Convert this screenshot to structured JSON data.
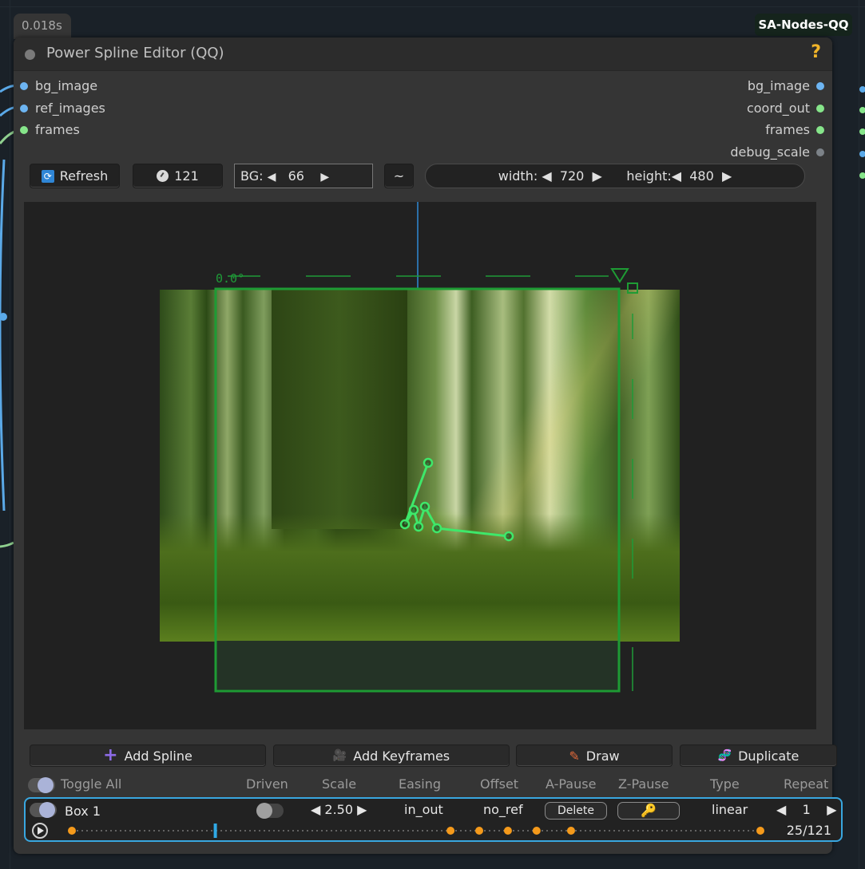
{
  "timing": "0.018s",
  "group_badge": "SA-Nodes-QQ",
  "node": {
    "title": "Power Spline Editor (QQ)",
    "help": "?",
    "inputs": [
      "bg_image",
      "ref_images",
      "frames"
    ],
    "outputs": [
      "bg_image",
      "coord_out",
      "frames",
      "debug_scale"
    ]
  },
  "toolbar": {
    "refresh_label": "Refresh",
    "frames_value": "121",
    "bg_label": "BG:",
    "bg_value": "66",
    "tilde_label": "~",
    "width_label": "width:",
    "width_value": "720",
    "height_label": "height:",
    "height_value": "480",
    "arrow_left": "◀",
    "arrow_right": "▶"
  },
  "canvas": {
    "rotation_label": "0.0°",
    "accent_green": "#22c34a",
    "spline_color": "#3ee86a",
    "guide_blue": "#2b6fa8"
  },
  "actions": {
    "add_spline": "Add Spline",
    "add_keyframes": "Add Keyframes",
    "draw": "Draw",
    "duplicate": "Duplicate"
  },
  "columns": {
    "toggle_all": "Toggle All",
    "driven": "Driven",
    "scale": "Scale",
    "easing": "Easing",
    "offset": "Offset",
    "a_pause": "A-Pause",
    "z_pause": "Z-Pause",
    "type": "Type",
    "repeat": "Repeat"
  },
  "row": {
    "name": "Box 1",
    "scale": "2.50",
    "easing": "in_out",
    "offset": "no_ref",
    "delete_label": "Delete",
    "type": "linear",
    "repeat": "1",
    "frame_counter": "25/121",
    "current_frame": 25,
    "total_frames": 121
  }
}
